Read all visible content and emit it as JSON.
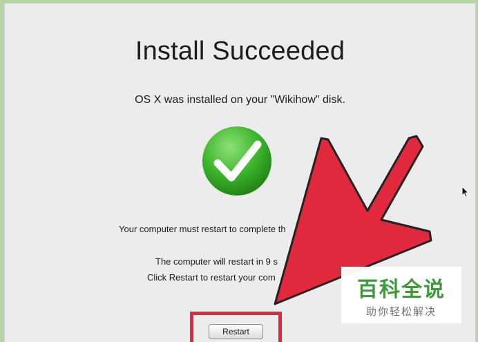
{
  "window": {
    "title": "Install Succeeded",
    "subtitle": "OS X was installed on your \"Wikihow\" disk.",
    "message_restart_required": "Your computer must restart to complete th",
    "message_countdown": "The computer will restart in 9 s",
    "message_click_restart": "Click Restart to restart your com",
    "restart_label": "Restart"
  },
  "overlay": {
    "watermark_main": "百科全说",
    "watermark_sub": "助你轻松解决",
    "arrow_color": "#e0293d",
    "check_color": "#3bb52a"
  },
  "icons": [
    "checkmark-icon",
    "pointer-arrow",
    "cursor-icon"
  ]
}
